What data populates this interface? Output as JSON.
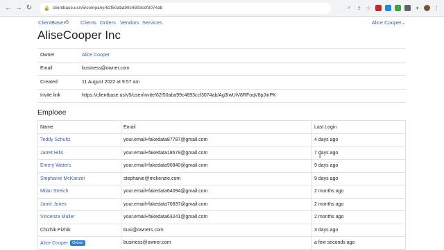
{
  "browser": {
    "url": "clientbase.us/v5/company/62f50aba99c4893ccf3074ab"
  },
  "nav": {
    "brand": "ClientBase",
    "version": "v5",
    "links": [
      "Clients",
      "Orders",
      "Vendors",
      "Services"
    ],
    "user": "Alice Cooper"
  },
  "company": {
    "title": "AliseCooper Inc",
    "fields": [
      {
        "label": "Owner",
        "value": "Alice Cooper"
      },
      {
        "label": "Email",
        "value": "business@owner.com"
      },
      {
        "label": "Created",
        "value": "11 August 2022 at 9:57 am"
      },
      {
        "label": "Invite link",
        "value": "https://clientbase.us/v5/user/invite/62f50aba99c4893ccf3074ab/Ag3IwUiV8RFoqV8pJinPK"
      }
    ]
  },
  "employees": {
    "heading": "Emploee",
    "columns": [
      "Name",
      "Email",
      "Last Login"
    ],
    "rows": [
      {
        "name": "Teddy Schultz",
        "email": "your.email+fakedata87787@gmail.com",
        "last": "4 days ago"
      },
      {
        "name": "Jarret Hills",
        "email": "your.email+fakedata18679@gmail.com",
        "last": "7 days ago"
      },
      {
        "name": "Emery Waters",
        "email": "your.email+fakedata90840@gmail.com",
        "last": "9 days ago"
      },
      {
        "name": "Stephanie McKanzei",
        "email": "stephanie@mckenzie.com",
        "last": "9 days ago"
      },
      {
        "name": "Milan Streich",
        "email": "your.email+fakedata64094@gmail.com",
        "last": "2 months ago"
      },
      {
        "name": "Jamir Jones",
        "email": "your.email+fakedata70837@gmail.com",
        "last": "2 months ago"
      },
      {
        "name": "Vincenza Muller",
        "email": "your.email+fakedata63241@gmail.com",
        "last": "2 months ago"
      },
      {
        "name": "Chizhik Pizhik",
        "email": "busi@owners.com",
        "last": "3 days ago"
      },
      {
        "name": "Alice Cooper",
        "email": "business@owner.com",
        "last": "a few seconds ago",
        "badge": "Owner"
      }
    ]
  }
}
